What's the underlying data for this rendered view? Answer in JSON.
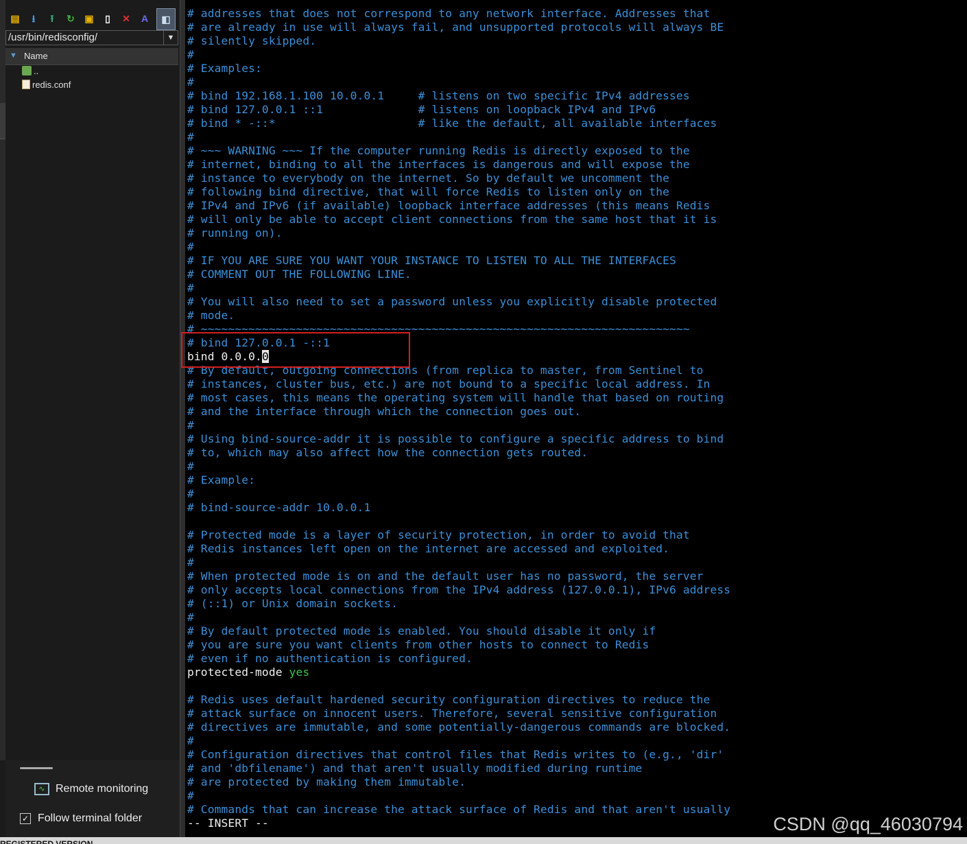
{
  "sidebar": {
    "toolbar": [
      {
        "name": "open-folder-icon",
        "glyph": "▤",
        "color": "#e8b300"
      },
      {
        "name": "download-icon",
        "glyph": "⭳",
        "color": "#4a9ee8"
      },
      {
        "name": "upload-icon",
        "glyph": "⭱",
        "color": "#2fb57a"
      },
      {
        "name": "refresh-icon",
        "glyph": "↻",
        "color": "#3cb043"
      },
      {
        "name": "new-folder-icon",
        "glyph": "▣",
        "color": "#e8b300"
      },
      {
        "name": "new-file-icon",
        "glyph": "▯",
        "color": "#ffffff"
      },
      {
        "name": "delete-icon",
        "glyph": "✕",
        "color": "#e03030"
      },
      {
        "name": "text-editor-icon",
        "glyph": "A",
        "color": "#6b6bf0"
      },
      {
        "name": "split-view-icon",
        "glyph": "◧",
        "color": "#cde"
      }
    ],
    "path": "/usr/bin/redisconfig/",
    "column_header": "Name",
    "files": [
      {
        "label": "..",
        "icon": "parent-folder-icon"
      },
      {
        "label": "redis.conf",
        "icon": "file-icon"
      }
    ],
    "remote_monitoring": "Remote monitoring",
    "follow_terminal_folder": "Follow terminal folder",
    "follow_checked": true
  },
  "terminal": {
    "lines_before_cursor": [
      "# addresses that does not correspond to any network interface. Addresses that",
      "# are already in use will always fail, and unsupported protocols will always BE",
      "# silently skipped.",
      "#",
      "# Examples:",
      "#",
      "# bind 192.168.1.100 10.0.0.1     # listens on two specific IPv4 addresses",
      "# bind 127.0.0.1 ::1              # listens on loopback IPv4 and IPv6",
      "# bind * -::*                     # like the default, all available interfaces",
      "#",
      "# ~~~ WARNING ~~~ If the computer running Redis is directly exposed to the",
      "# internet, binding to all the interfaces is dangerous and will expose the",
      "# instance to everybody on the internet. So by default we uncomment the",
      "# following bind directive, that will force Redis to listen only on the",
      "# IPv4 and IPv6 (if available) loopback interface addresses (this means Redis",
      "# will only be able to accept client connections from the same host that it is",
      "# running on).",
      "#",
      "# IF YOU ARE SURE YOU WANT YOUR INSTANCE TO LISTEN TO ALL THE INTERFACES",
      "# COMMENT OUT THE FOLLOWING LINE.",
      "#",
      "# You will also need to set a password unless you explicitly disable protected",
      "# mode.",
      "# ~~~~~~~~~~~~~~~~~~~~~~~~~~~~~~~~~~~~~~~~~~~~~~~~~~~~~~~~~~~~~~~~~~~~~~~~",
      "# bind 127.0.0.1 -::1"
    ],
    "cursor_line_text": "bind 0.0.0.",
    "cursor_char": "0",
    "lines_mid": [
      "# By default, outgoing connections (from replica to master, from Sentinel to",
      "# instances, cluster bus, etc.) are not bound to a specific local address. In",
      "# most cases, this means the operating system will handle that based on routing",
      "# and the interface through which the connection goes out.",
      "#",
      "# Using bind-source-addr it is possible to configure a specific address to bind",
      "# to, which may also affect how the connection gets routed.",
      "#",
      "# Example:",
      "#",
      "# bind-source-addr 10.0.0.1",
      "",
      "# Protected mode is a layer of security protection, in order to avoid that",
      "# Redis instances left open on the internet are accessed and exploited.",
      "#",
      "# When protected mode is on and the default user has no password, the server",
      "# only accepts local connections from the IPv4 address (127.0.0.1), IPv6 address",
      "# (::1) or Unix domain sockets.",
      "#",
      "# By default protected mode is enabled. You should disable it only if",
      "# you are sure you want clients from other hosts to connect to Redis",
      "# even if no authentication is configured."
    ],
    "protected_mode_key": "protected-mode ",
    "protected_mode_value": "yes",
    "lines_after": [
      "",
      "# Redis uses default hardened security configuration directives to reduce the",
      "# attack surface on innocent users. Therefore, several sensitive configuration",
      "# directives are immutable, and some potentially-dangerous commands are blocked.",
      "#",
      "# Configuration directives that control files that Redis writes to (e.g., 'dir'",
      "# and 'dbfilename') and that aren't usually modified during runtime",
      "# are protected by making them immutable.",
      "#",
      "# Commands that can increase the attack surface of Redis and that aren't usually"
    ],
    "status_line": "-- INSERT --",
    "colors": {
      "comment": "#3b8fd8",
      "code": "#f0f0f0",
      "value": "#3ec24a",
      "highlight": "#d42020"
    }
  },
  "watermark": "CSDN @qq_46030794",
  "bottom_bar": "REGISTERED VERSION"
}
